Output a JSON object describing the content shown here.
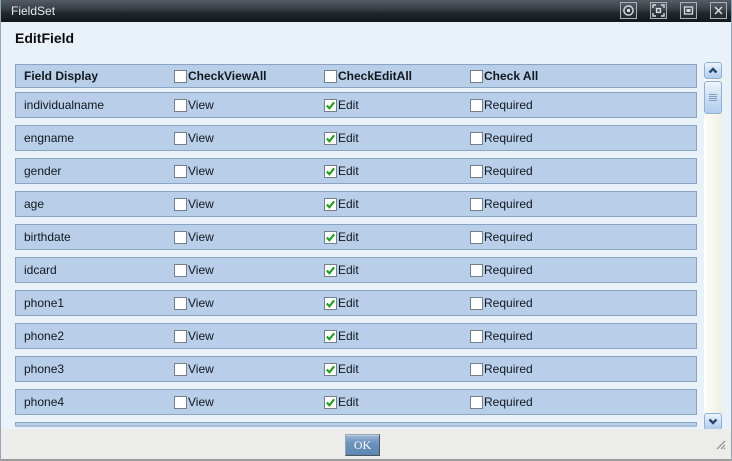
{
  "window": {
    "title": "FieldSet",
    "controls": [
      {
        "name": "shade",
        "icon": "shade-icon"
      },
      {
        "name": "maximize",
        "icon": "maximize-icon"
      },
      {
        "name": "restore",
        "icon": "restore-icon"
      },
      {
        "name": "close",
        "icon": "close-icon"
      }
    ]
  },
  "heading": "EditField",
  "table": {
    "header": {
      "field_label": "Field Display",
      "check_view_all": "CheckViewAll",
      "check_edit_all": "CheckEditAll",
      "check_all": "Check All",
      "check_view_all_checked": false,
      "check_edit_all_checked": false,
      "check_all_checked": false
    },
    "col_labels": {
      "view": "View",
      "edit": "Edit",
      "required": "Required"
    },
    "rows": [
      {
        "field": "individualname",
        "view": false,
        "edit": true,
        "required": false
      },
      {
        "field": "engname",
        "view": false,
        "edit": true,
        "required": false
      },
      {
        "field": "gender",
        "view": false,
        "edit": true,
        "required": false
      },
      {
        "field": "age",
        "view": false,
        "edit": true,
        "required": false
      },
      {
        "field": "birthdate",
        "view": false,
        "edit": true,
        "required": false
      },
      {
        "field": "idcard",
        "view": false,
        "edit": true,
        "required": false
      },
      {
        "field": "phone1",
        "view": false,
        "edit": true,
        "required": false
      },
      {
        "field": "phone2",
        "view": false,
        "edit": true,
        "required": false
      },
      {
        "field": "phone3",
        "view": false,
        "edit": true,
        "required": false
      },
      {
        "field": "phone4",
        "view": false,
        "edit": true,
        "required": false
      }
    ],
    "clipped_next_row": true
  },
  "scrollbar": {
    "up_icon": "chevron-up-icon",
    "down_icon": "chevron-down-icon",
    "thumb": "scrollbar-thumb"
  },
  "footer": {
    "ok_label": "OK",
    "resize_icon": "resize-grip-icon"
  },
  "colors": {
    "titlebar_top": "#545c63",
    "titlebar_bottom": "#14171b",
    "content_bg": "#e9f1f9",
    "row_bg": "#b9cee8",
    "row_border": "#8ba4c4",
    "footer_bg": "#ececea",
    "check_green": "#1f9e1f",
    "ok_button_blue": "#6d93bd",
    "scroll_button_blue": "#b2ccec",
    "scroll_track": "#f0efe3"
  }
}
